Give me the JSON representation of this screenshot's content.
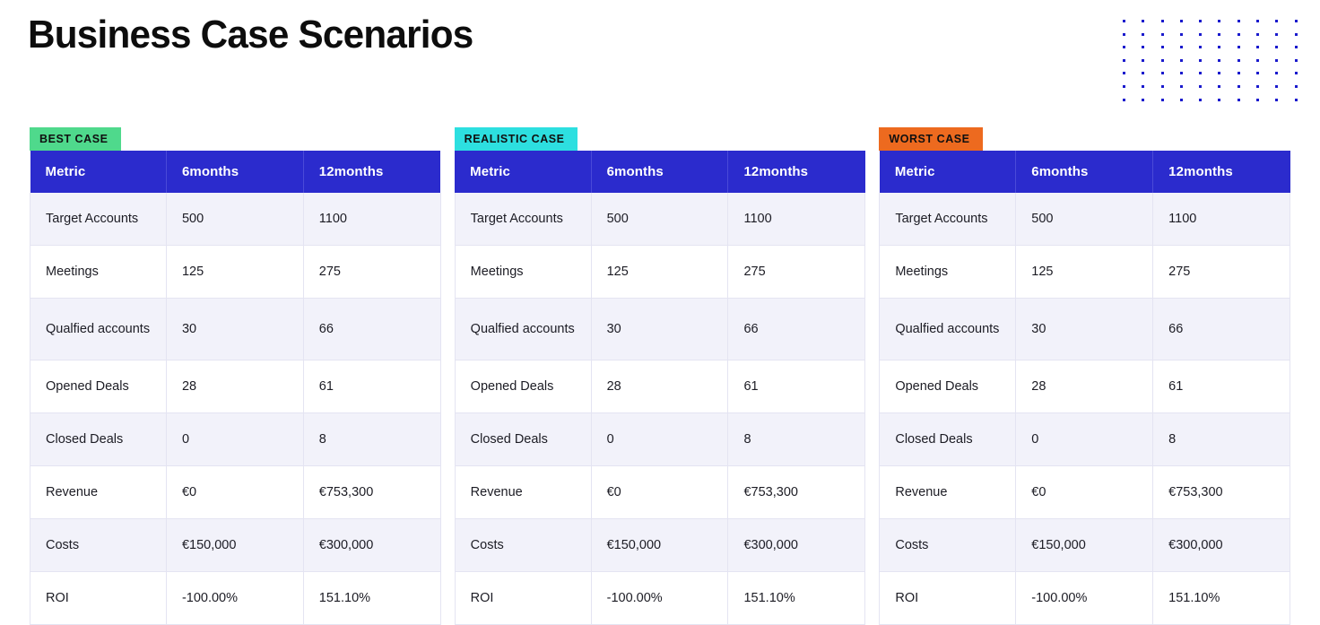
{
  "header": {
    "title": "Business Case Scenarios",
    "decoration": {
      "icon": "dot-grid-icon",
      "columns": 10,
      "rows": 7,
      "color": "#1a1acd"
    }
  },
  "colors": {
    "header_blue": "#2b2bcd",
    "row_stripe": "#f2f2fa",
    "best_case_badge": "#4fd98c",
    "realistic_case_badge": "#2ddfe0",
    "worst_case_badge": "#ed6a1f",
    "title_text": "#0d0d0d"
  },
  "columns": [
    "Metric",
    "6months",
    "12months"
  ],
  "cases": [
    {
      "badge": "BEST CASE",
      "badge_color": "#4fd98c",
      "rows": [
        {
          "metric": "Target Accounts",
          "m6": "500",
          "m12": "1100"
        },
        {
          "metric": "Meetings",
          "m6": "125",
          "m12": "275"
        },
        {
          "metric": "Qualfied accounts",
          "m6": "30",
          "m12": "66"
        },
        {
          "metric": "Opened Deals",
          "m6": "28",
          "m12": "61"
        },
        {
          "metric": "Closed Deals",
          "m6": "0",
          "m12": "8"
        },
        {
          "metric": "Revenue",
          "m6": "€0",
          "m12": "€753,300"
        },
        {
          "metric": "Costs",
          "m6": "€150,000",
          "m12": "€300,000"
        },
        {
          "metric": "ROI",
          "m6": "-100.00%",
          "m12": "151.10%"
        }
      ]
    },
    {
      "badge": "REALISTIC CASE",
      "badge_color": "#2ddfe0",
      "rows": [
        {
          "metric": "Target Accounts",
          "m6": "500",
          "m12": "1100"
        },
        {
          "metric": "Meetings",
          "m6": "125",
          "m12": "275"
        },
        {
          "metric": "Qualfied accounts",
          "m6": "30",
          "m12": "66"
        },
        {
          "metric": "Opened Deals",
          "m6": "28",
          "m12": "61"
        },
        {
          "metric": "Closed Deals",
          "m6": "0",
          "m12": "8"
        },
        {
          "metric": "Revenue",
          "m6": "€0",
          "m12": "€753,300"
        },
        {
          "metric": "Costs",
          "m6": "€150,000",
          "m12": "€300,000"
        },
        {
          "metric": "ROI",
          "m6": "-100.00%",
          "m12": "151.10%"
        }
      ]
    },
    {
      "badge": "WORST CASE",
      "badge_color": "#ed6a1f",
      "rows": [
        {
          "metric": "Target Accounts",
          "m6": "500",
          "m12": "1100"
        },
        {
          "metric": "Meetings",
          "m6": "125",
          "m12": "275"
        },
        {
          "metric": "Qualfied accounts",
          "m6": "30",
          "m12": "66"
        },
        {
          "metric": "Opened Deals",
          "m6": "28",
          "m12": "61"
        },
        {
          "metric": "Closed Deals",
          "m6": "0",
          "m12": "8"
        },
        {
          "metric": "Revenue",
          "m6": "€0",
          "m12": "€753,300"
        },
        {
          "metric": "Costs",
          "m6": "€150,000",
          "m12": "€300,000"
        },
        {
          "metric": "ROI",
          "m6": "-100.00%",
          "m12": "151.10%"
        }
      ]
    }
  ]
}
